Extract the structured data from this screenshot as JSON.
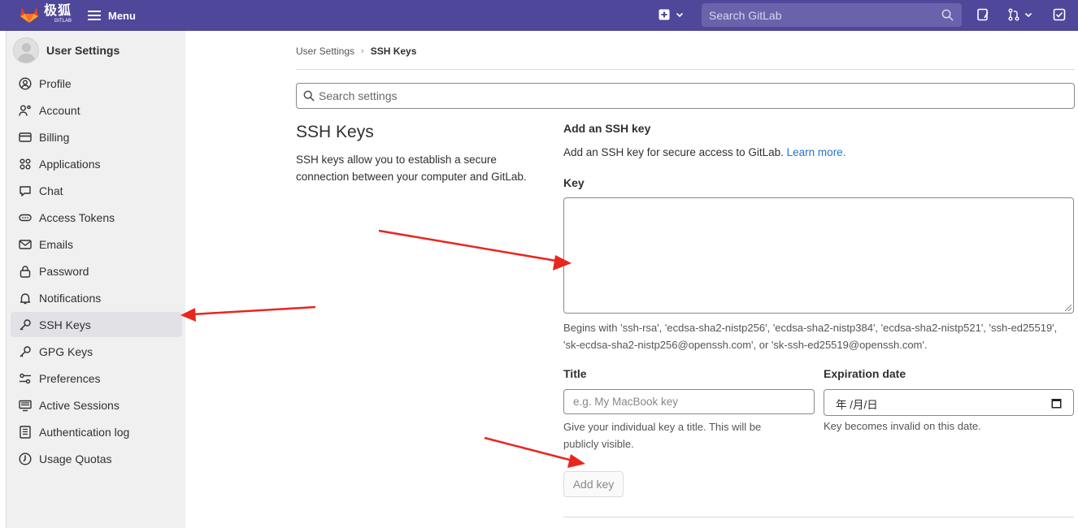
{
  "topbar": {
    "logo_cn": "极狐",
    "logo_en": "GITLAB",
    "menu_label": "Menu",
    "search_placeholder": "Search GitLab",
    "bg_color": "#4f479a"
  },
  "sidebar": {
    "title": "User Settings",
    "items": [
      {
        "label": "Profile",
        "icon": "profile-icon"
      },
      {
        "label": "Account",
        "icon": "account-icon"
      },
      {
        "label": "Billing",
        "icon": "billing-icon"
      },
      {
        "label": "Applications",
        "icon": "applications-icon"
      },
      {
        "label": "Chat",
        "icon": "chat-icon"
      },
      {
        "label": "Access Tokens",
        "icon": "token-icon"
      },
      {
        "label": "Emails",
        "icon": "email-icon"
      },
      {
        "label": "Password",
        "icon": "lock-icon"
      },
      {
        "label": "Notifications",
        "icon": "bell-icon"
      },
      {
        "label": "SSH Keys",
        "icon": "key-icon",
        "active": true
      },
      {
        "label": "GPG Keys",
        "icon": "key-icon"
      },
      {
        "label": "Preferences",
        "icon": "preferences-icon"
      },
      {
        "label": "Active Sessions",
        "icon": "monitor-icon"
      },
      {
        "label": "Authentication log",
        "icon": "log-icon"
      },
      {
        "label": "Usage Quotas",
        "icon": "quota-icon"
      }
    ]
  },
  "breadcrumb": {
    "parent": "User Settings",
    "current": "SSH Keys"
  },
  "search_settings": {
    "placeholder": "Search settings"
  },
  "section": {
    "heading": "SSH Keys",
    "description": "SSH keys allow you to establish a secure connection between your computer and GitLab."
  },
  "form": {
    "title": "Add an SSH key",
    "description": "Add an SSH key for secure access to GitLab.",
    "learn_more": "Learn more.",
    "key_label": "Key",
    "key_help": "Begins with 'ssh-rsa', 'ecdsa-sha2-nistp256', 'ecdsa-sha2-nistp384', 'ecdsa-sha2-nistp521', 'ssh-ed25519', 'sk-ecdsa-sha2-nistp256@openssh.com', or 'sk-ssh-ed25519@openssh.com'.",
    "title_label": "Title",
    "title_placeholder": "e.g. My MacBook key",
    "title_help": "Give your individual key a title. This will be publicly visible.",
    "expiration_label": "Expiration date",
    "expiration_value": "年 /月/日",
    "expiration_help": "Key becomes invalid on this date.",
    "add_button": "Add key"
  },
  "annotation_color": "#e8261e"
}
